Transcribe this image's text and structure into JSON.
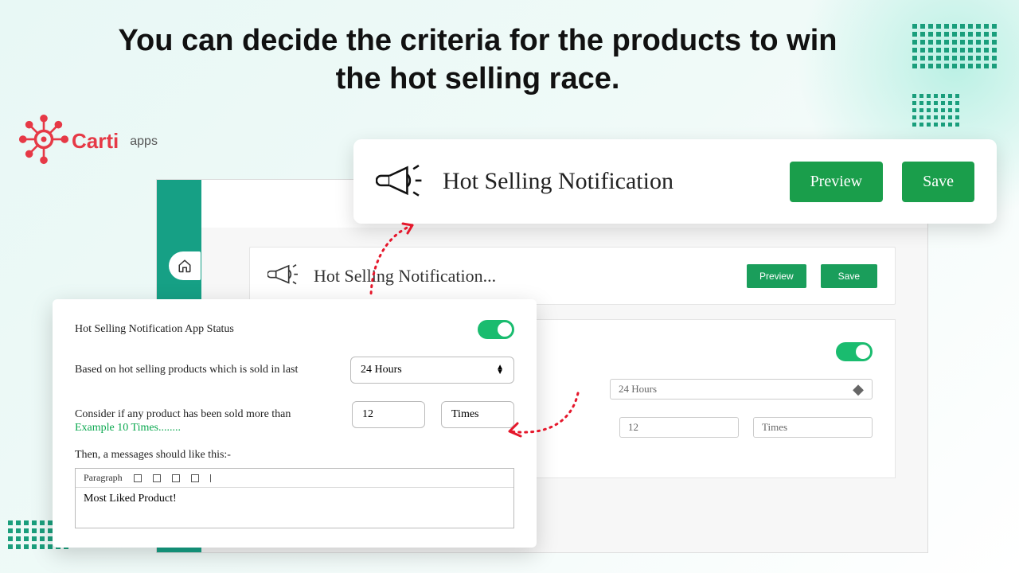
{
  "headline": "You can decide the criteria for the products to win the hot selling race.",
  "brand": {
    "name": "Carti",
    "suffix": "apps"
  },
  "hero": {
    "title": "Hot Selling Notification",
    "preview": "Preview",
    "save": "Save"
  },
  "app_card": {
    "title": "Hot Selling Notification...",
    "preview": "Preview",
    "save": "Save"
  },
  "bg_panel": {
    "duration": "24 Hours",
    "count": "12",
    "unit": "Times"
  },
  "settings": {
    "status_label": "Hot Selling Notification App Status",
    "based_label": "Based on hot selling products which is sold in last",
    "duration": "24 Hours",
    "consider_label": "Consider if any product has been sold more than",
    "example": "Example 10 Times........",
    "count": "12",
    "unit_label": "Times",
    "message_label": "Then, a messages should like this:-",
    "editor_format": "Paragraph",
    "editor_content": "Most Liked Product!"
  }
}
